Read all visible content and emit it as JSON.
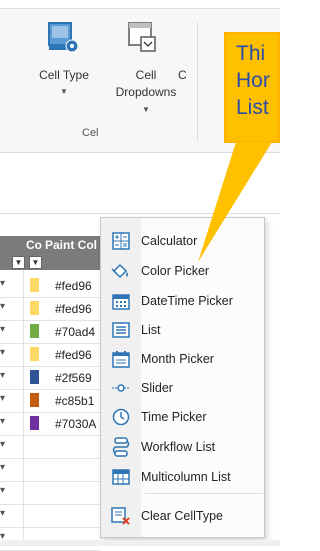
{
  "ribbon": {
    "cell_type_label": "Cell Type",
    "cell_dropdowns_label": "Cell Dropdowns",
    "cell_dropdowns_line1": "Cell",
    "cell_dropdowns_line2": "Dropdowns",
    "partial_next_label": "C",
    "group_label": "Cel"
  },
  "sheet": {
    "header_partial_left": "Co",
    "header_paint_color": "Paint Col",
    "rows": [
      {
        "swatch": "#fed966",
        "hex": "#fed96"
      },
      {
        "swatch": "#fed966",
        "hex": "#fed96"
      },
      {
        "swatch": "#70ad47",
        "hex": "#70ad4"
      },
      {
        "swatch": "#fed966",
        "hex": "#fed96"
      },
      {
        "swatch": "#2f5597",
        "hex": "#2f569"
      },
      {
        "swatch": "#c55a11",
        "hex": "#c85b1"
      },
      {
        "swatch": "#7030a0",
        "hex": "#7030A"
      }
    ],
    "extra_rows": 5
  },
  "menu": {
    "items": [
      {
        "label": "Calculator",
        "icon": "calculator-icon"
      },
      {
        "label": "Color Picker",
        "icon": "color-picker-icon"
      },
      {
        "label": "DateTime Picker",
        "icon": "calendar-icon"
      },
      {
        "label": "List",
        "icon": "list-icon"
      },
      {
        "label": "Month Picker",
        "icon": "month-calendar-icon"
      },
      {
        "label": "Slider",
        "icon": "slider-icon"
      },
      {
        "label": "Time Picker",
        "icon": "clock-icon"
      },
      {
        "label": "Workflow List",
        "icon": "workflow-icon"
      },
      {
        "label": "Multicolumn List",
        "icon": "multicolumn-icon"
      },
      {
        "label": "Clear CellType",
        "icon": "clear-celltype-icon"
      }
    ]
  },
  "callout": {
    "lines": [
      "Thi",
      "Hor",
      "List"
    ],
    "color": "#ffc000",
    "text_color": "#2a4da6"
  },
  "colors": {
    "header_bg": "#7b7b7b",
    "accent_blue": "#2e75b6"
  }
}
